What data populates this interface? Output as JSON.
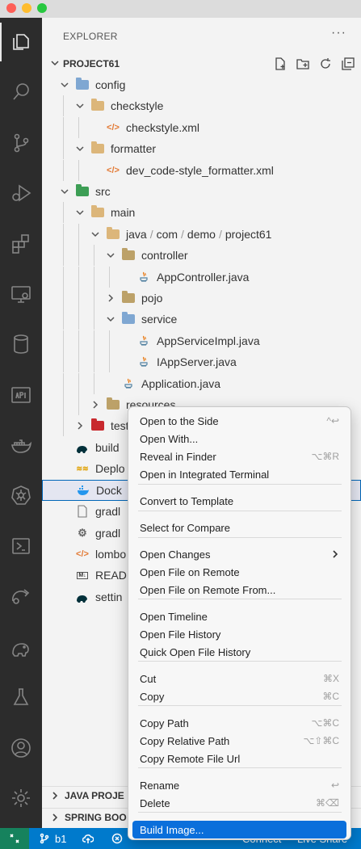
{
  "sidebar": {
    "title": "EXPLORER",
    "more": "···",
    "project_label": "PROJECT61"
  },
  "tree": [
    {
      "label": "config"
    },
    {
      "label": "checkstyle"
    },
    {
      "label": "checkstyle.xml"
    },
    {
      "label": "formatter"
    },
    {
      "label": "dev_code-style_formatter.xml"
    },
    {
      "label": "src"
    },
    {
      "label": "main"
    },
    {
      "path": [
        "java",
        "com",
        "demo",
        "project61"
      ]
    },
    {
      "label": "controller"
    },
    {
      "label": "AppController.java"
    },
    {
      "label": "pojo"
    },
    {
      "label": "service"
    },
    {
      "label": "AppServiceImpl.java"
    },
    {
      "label": "IAppServer.java"
    },
    {
      "label": "Application.java"
    },
    {
      "label": "resources"
    },
    {
      "label": "test"
    },
    {
      "label": "build"
    },
    {
      "label": "Deplo"
    },
    {
      "label": "Dock"
    },
    {
      "label": "gradl"
    },
    {
      "label": "gradl"
    },
    {
      "label": "lombo"
    },
    {
      "label": "READ"
    },
    {
      "label": "settin"
    }
  ],
  "sections": {
    "java_projects": "JAVA PROJE",
    "spring_boot": "SPRING BOO"
  },
  "statusbar": {
    "branch": "b1",
    "connect": "Connect",
    "live_share": "Live Share"
  },
  "context_menu": {
    "items": [
      {
        "label": "Open to the Side",
        "shortcut": "^↩"
      },
      {
        "label": "Open With...",
        "shortcut": ""
      },
      {
        "label": "Reveal in Finder",
        "shortcut": "⌥⌘R"
      },
      {
        "label": "Open in Integrated Terminal",
        "shortcut": ""
      },
      {
        "label": "Convert to Template",
        "shortcut": ""
      },
      {
        "label": "Select for Compare",
        "shortcut": ""
      },
      {
        "label": "Open Changes",
        "shortcut": ""
      },
      {
        "label": "Open File on Remote",
        "shortcut": ""
      },
      {
        "label": "Open File on Remote From...",
        "shortcut": ""
      },
      {
        "label": "Open Timeline",
        "shortcut": ""
      },
      {
        "label": "Open File History",
        "shortcut": ""
      },
      {
        "label": "Quick Open File History",
        "shortcut": ""
      },
      {
        "label": "Cut",
        "shortcut": "⌘X"
      },
      {
        "label": "Copy",
        "shortcut": "⌘C"
      },
      {
        "label": "Copy Path",
        "shortcut": "⌥⌘C"
      },
      {
        "label": "Copy Relative Path",
        "shortcut": "⌥⇧⌘C"
      },
      {
        "label": "Copy Remote File Url",
        "shortcut": ""
      },
      {
        "label": "Rename",
        "shortcut": "↩"
      },
      {
        "label": "Delete",
        "shortcut": "⌘⌫"
      },
      {
        "label": "Build Image...",
        "shortcut": ""
      }
    ]
  },
  "colors": {
    "accent": "#007acc",
    "menu_highlight": "#0a6fdb",
    "remote": "#16825d"
  }
}
